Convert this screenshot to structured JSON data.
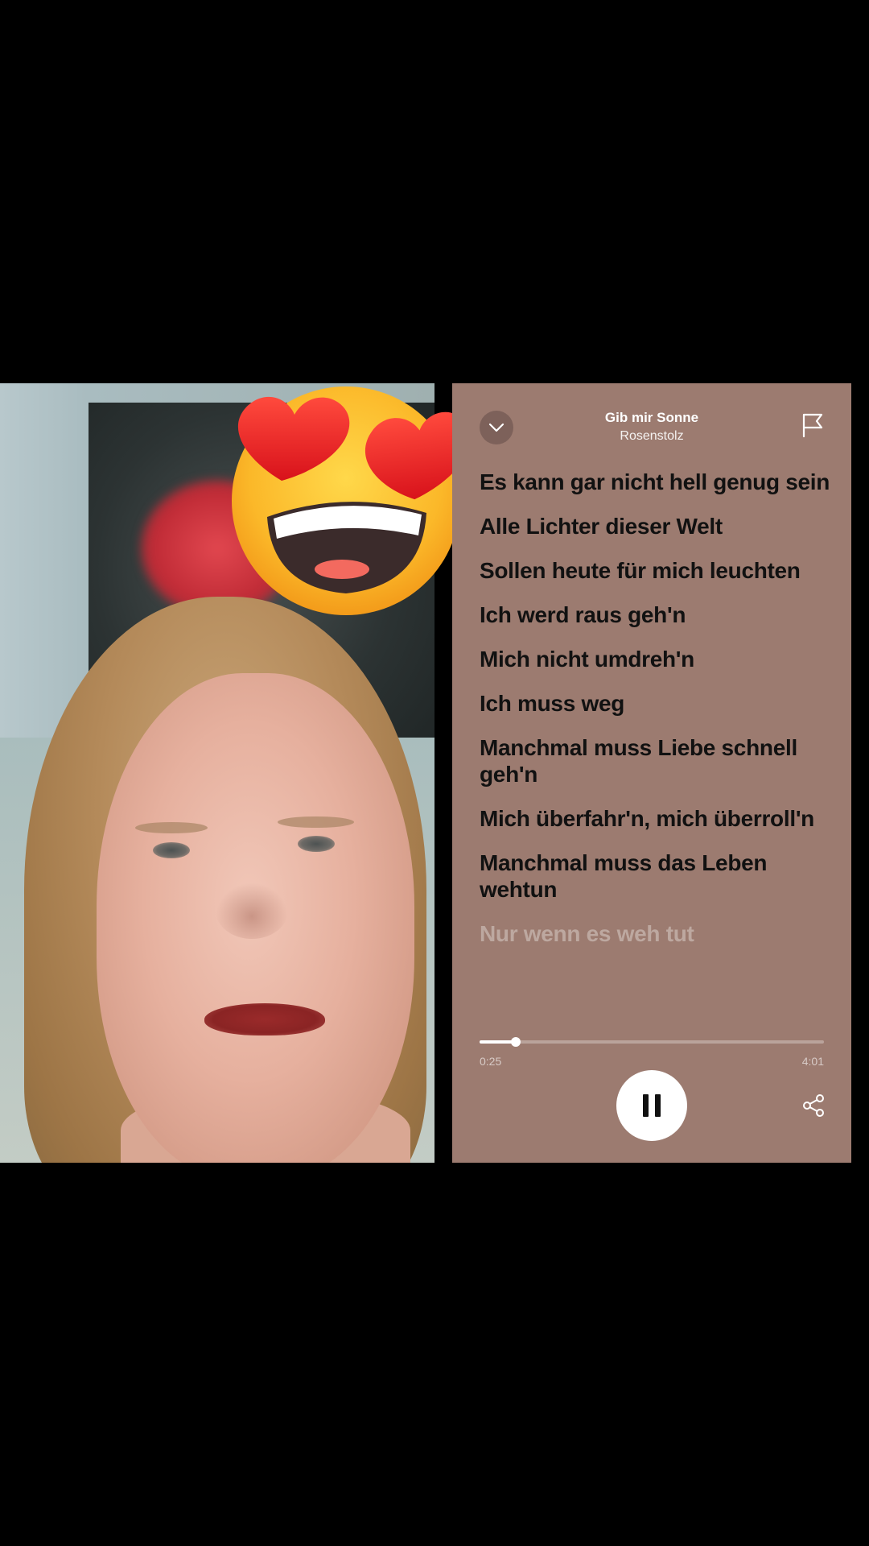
{
  "player": {
    "track_title": "Gib mir Sonne",
    "artist": "Rosenstolz",
    "lyrics": [
      "Es kann gar nicht hell genug sein",
      "Alle Lichter dieser Welt",
      "Sollen heute für mich leuchten",
      "Ich werd raus geh'n",
      "Mich nicht umdreh'n",
      "Ich muss weg",
      "Manchmal muss Liebe schnell geh'n",
      "Mich überfahr'n, mich überroll'n",
      "Manchmal muss das Leben wehtun",
      "Nur wenn es weh tut"
    ],
    "time_elapsed": "0:25",
    "time_total": "4:01",
    "progress_fraction": 0.104,
    "card_color": "#9c7b70",
    "icons": {
      "collapse": "chevron-down-icon",
      "report": "flag-icon",
      "play_state": "pause-icon",
      "share": "share-icon"
    }
  },
  "sticker": {
    "icon": "heart-eyes-emoji-icon"
  }
}
